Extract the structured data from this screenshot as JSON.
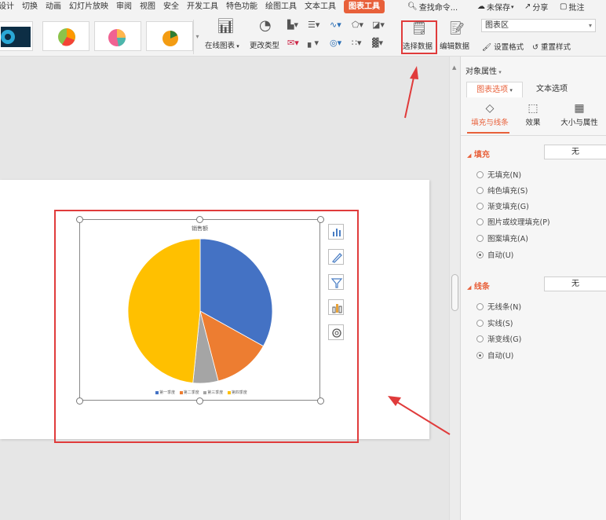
{
  "menubar": {
    "tabs": [
      "设计",
      "切换",
      "动画",
      "幻灯片放映",
      "审阅",
      "视图",
      "安全",
      "开发工具",
      "特色功能",
      "绘图工具",
      "文本工具",
      "图表工具"
    ],
    "search": "查找命令...",
    "unsaved": "未保存",
    "share": "分享",
    "comment": "批注"
  },
  "ribbon": {
    "online_chart": "在线图表",
    "change_type": "更改类型",
    "select_data": "选择数据",
    "edit_data": "编辑数据",
    "chart_area": "图表区",
    "format_setting": "设置格式",
    "reset_style": "重置样式"
  },
  "chart_data": {
    "type": "pie",
    "title": "销售额",
    "categories": [
      "第一季度",
      "第二季度",
      "第三季度",
      "第四季度"
    ],
    "values": [
      8.2,
      3.2,
      1.4,
      12
    ],
    "colors": [
      "#4472c4",
      "#ed7d31",
      "#a5a5a5",
      "#ffc000"
    ]
  },
  "pane": {
    "title": "对象属性",
    "tab_chart": "图表选项",
    "tab_text": "文本选项",
    "subtabs": [
      "填充与线条",
      "效果",
      "大小与属性"
    ],
    "fill": {
      "title": "填充",
      "value": "无",
      "options": [
        "无填充(N)",
        "纯色填充(S)",
        "渐变填充(G)",
        "图片或纹理填充(P)",
        "图案填充(A)",
        "自动(U)"
      ]
    },
    "line": {
      "title": "线条",
      "value": "无",
      "options": [
        "无线条(N)",
        "实线(S)",
        "渐变线(G)",
        "自动(U)"
      ]
    }
  }
}
